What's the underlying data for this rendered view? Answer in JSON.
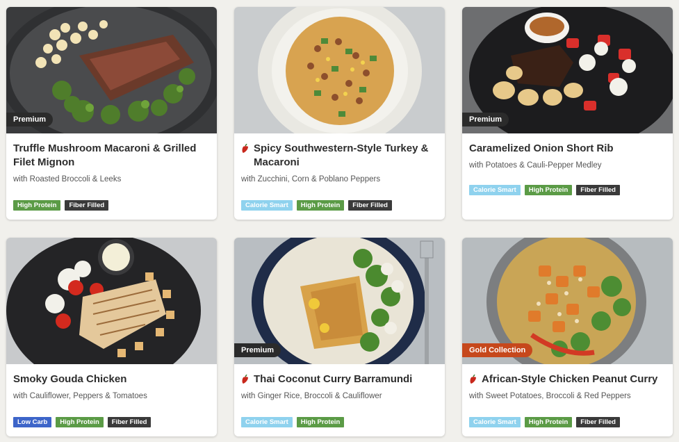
{
  "cards": [
    {
      "ribbon": "Premium",
      "spicy": false,
      "title": "Truffle Mushroom Macaroni & Grilled Filet Mignon",
      "subtitle": "with Roasted Broccoli & Leeks",
      "tags": [
        "High Protein",
        "Fiber Filled"
      ]
    },
    {
      "ribbon": "",
      "spicy": true,
      "title": "Spicy Southwestern-Style Turkey & Macaroni",
      "subtitle": "with Zucchini, Corn & Poblano Peppers",
      "tags": [
        "Calorie Smart",
        "High Protein",
        "Fiber Filled"
      ]
    },
    {
      "ribbon": "Premium",
      "spicy": false,
      "title": "Caramelized Onion Short Rib",
      "subtitle": "with Potatoes & Cauli-Pepper Medley",
      "tags": [
        "Calorie Smart",
        "High Protein",
        "Fiber Filled"
      ]
    },
    {
      "ribbon": "",
      "spicy": false,
      "title": "Smoky Gouda Chicken",
      "subtitle": "with Cauliflower, Peppers & Tomatoes",
      "tags": [
        "Low Carb",
        "High Protein",
        "Fiber Filled"
      ]
    },
    {
      "ribbon": "Premium",
      "spicy": true,
      "title": "Thai Coconut Curry Barramundi",
      "subtitle": "with Ginger Rice, Broccoli & Cauliflower",
      "tags": [
        "Calorie Smart",
        "High Protein"
      ]
    },
    {
      "ribbon": "Gold Collection",
      "spicy": true,
      "title": "African-Style Chicken Peanut Curry",
      "subtitle": "with Sweet Potatoes, Broccoli & Red Peppers",
      "tags": [
        "Calorie Smart",
        "High Protein",
        "Fiber Filled"
      ]
    }
  ],
  "colors": {
    "high_protein": "#5b9b46",
    "fiber_filled": "#3a3a3a",
    "calorie_smart": "#8fd2ee",
    "low_carb": "#3d65c9",
    "premium_ribbon": "#2b2b2b",
    "gold_ribbon": "#c6481c",
    "chili": "#c8281c"
  },
  "icons": {
    "spicy": "chili-pepper-icon"
  }
}
